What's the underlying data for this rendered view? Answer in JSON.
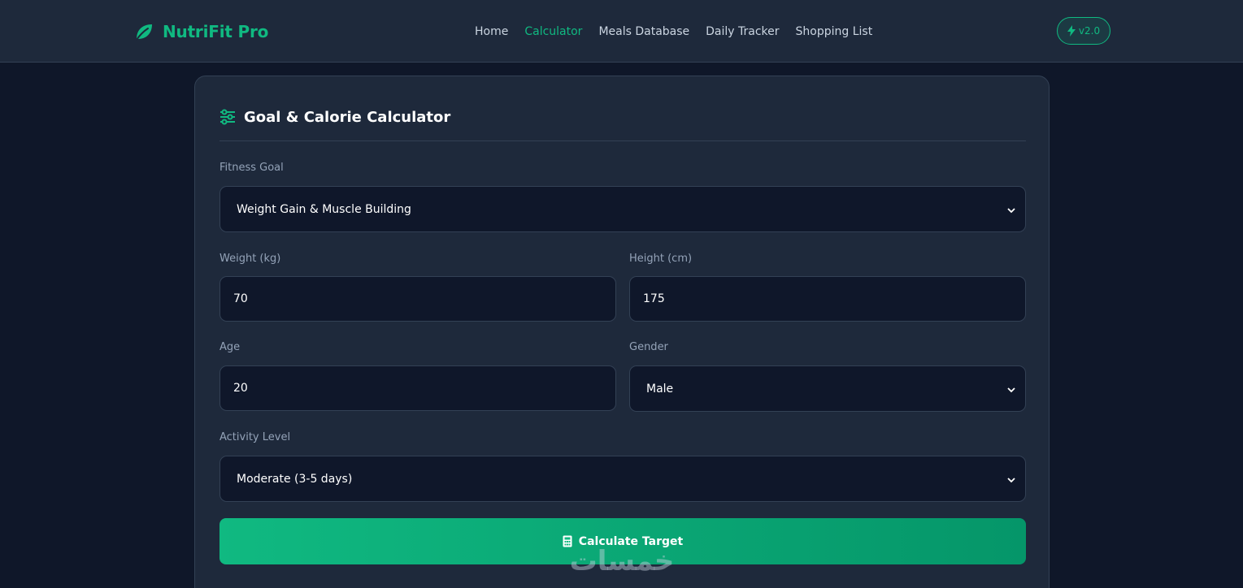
{
  "brand": {
    "name": "NutriFit Pro",
    "icon": "leaf-icon",
    "color": "#10b981"
  },
  "nav": {
    "items": [
      {
        "label": "Home",
        "active": false
      },
      {
        "label": "Calculator",
        "active": true
      },
      {
        "label": "Meals Database",
        "active": false
      },
      {
        "label": "Daily Tracker",
        "active": false
      },
      {
        "label": "Shopping List",
        "active": false
      }
    ]
  },
  "version": {
    "label": "v2.0",
    "icon": "bolt-icon"
  },
  "calculator": {
    "title": "Goal & Calorie Calculator",
    "icon": "sliders-icon",
    "fitness_goal": {
      "label": "Fitness Goal",
      "value": "Weight Gain & Muscle Building"
    },
    "weight": {
      "label": "Weight (kg)",
      "value": "70"
    },
    "height": {
      "label": "Height (cm)",
      "value": "175"
    },
    "age": {
      "label": "Age",
      "value": "20"
    },
    "gender": {
      "label": "Gender",
      "value": "Male"
    },
    "activity": {
      "label": "Activity Level",
      "value": "Moderate (3-5 days)"
    },
    "button": {
      "label": "Calculate Target",
      "icon": "calculator-icon"
    }
  },
  "watermark": {
    "text": "خمسات"
  },
  "colors": {
    "accent": "#10b981",
    "background": "#0f1729",
    "card": "#1e293b"
  }
}
